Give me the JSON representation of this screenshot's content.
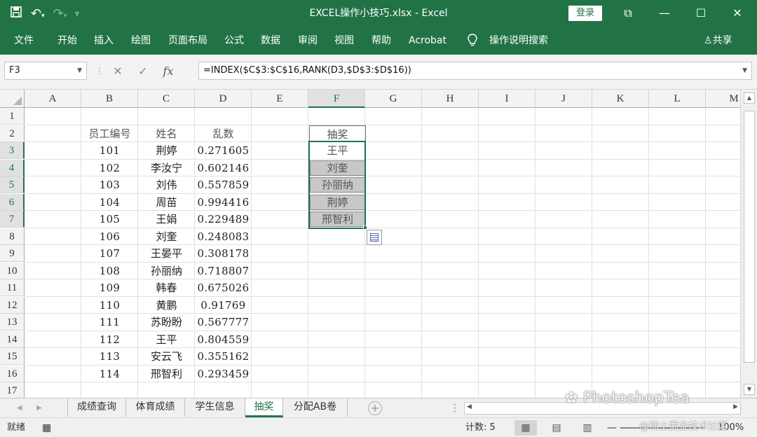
{
  "window": {
    "title": "EXCEL操作小技巧.xlsx  -  Excel",
    "login_label": "登录",
    "controls": [
      "⧉",
      "—",
      "☐",
      "✕"
    ]
  },
  "ribbon": {
    "tabs": [
      "文件",
      "开始",
      "插入",
      "绘图",
      "页面布局",
      "公式",
      "数据",
      "审阅",
      "视图",
      "帮助",
      "Acrobat"
    ],
    "tell_me": "操作说明搜索",
    "share": "共享"
  },
  "formula_bar": {
    "name_box": "F3",
    "formula": "=INDEX($C$3:$C$16,RANK(D3,$D$3:$D$16))"
  },
  "columns": [
    "A",
    "B",
    "C",
    "D",
    "E",
    "F",
    "G",
    "H",
    "I",
    "J",
    "K",
    "L",
    "M"
  ],
  "rows": [
    "1",
    "2",
    "3",
    "4",
    "5",
    "6",
    "7",
    "8",
    "9",
    "10",
    "11",
    "12",
    "13",
    "14",
    "15",
    "16",
    "17"
  ],
  "table": {
    "headers": [
      "员工编号",
      "姓名",
      "乱数"
    ],
    "data": [
      [
        "101",
        "荆婷",
        "0.271605"
      ],
      [
        "102",
        "李汝宁",
        "0.602146"
      ],
      [
        "103",
        "刘伟",
        "0.557859"
      ],
      [
        "104",
        "周苗",
        "0.994416"
      ],
      [
        "105",
        "王娟",
        "0.229489"
      ],
      [
        "106",
        "刘奎",
        "0.248083"
      ],
      [
        "107",
        "王晏平",
        "0.308178"
      ],
      [
        "108",
        "孙丽纳",
        "0.718807"
      ],
      [
        "109",
        "韩春",
        "0.675026"
      ],
      [
        "110",
        "黄鹏",
        "0.91769"
      ],
      [
        "111",
        "苏盼盼",
        "0.567777"
      ],
      [
        "112",
        "王平",
        "0.804559"
      ],
      [
        "113",
        "安云飞",
        "0.355162"
      ],
      [
        "114",
        "邢智利",
        "0.293459"
      ]
    ]
  },
  "lottery": {
    "header": "抽奖",
    "winners": [
      "王平",
      "刘奎",
      "孙丽纳",
      "荆婷",
      "邢智利"
    ]
  },
  "sheets": {
    "tabs": [
      "成绩查询",
      "体育成绩",
      "学生信息",
      "抽奖",
      "分配AB卷"
    ],
    "active": "抽奖"
  },
  "status": {
    "mode": "就绪",
    "count": "计数: 5",
    "zoom": "100%"
  },
  "watermark": {
    "main": "PhotoshopTea",
    "sub": "@稀土掘金技术社区"
  }
}
